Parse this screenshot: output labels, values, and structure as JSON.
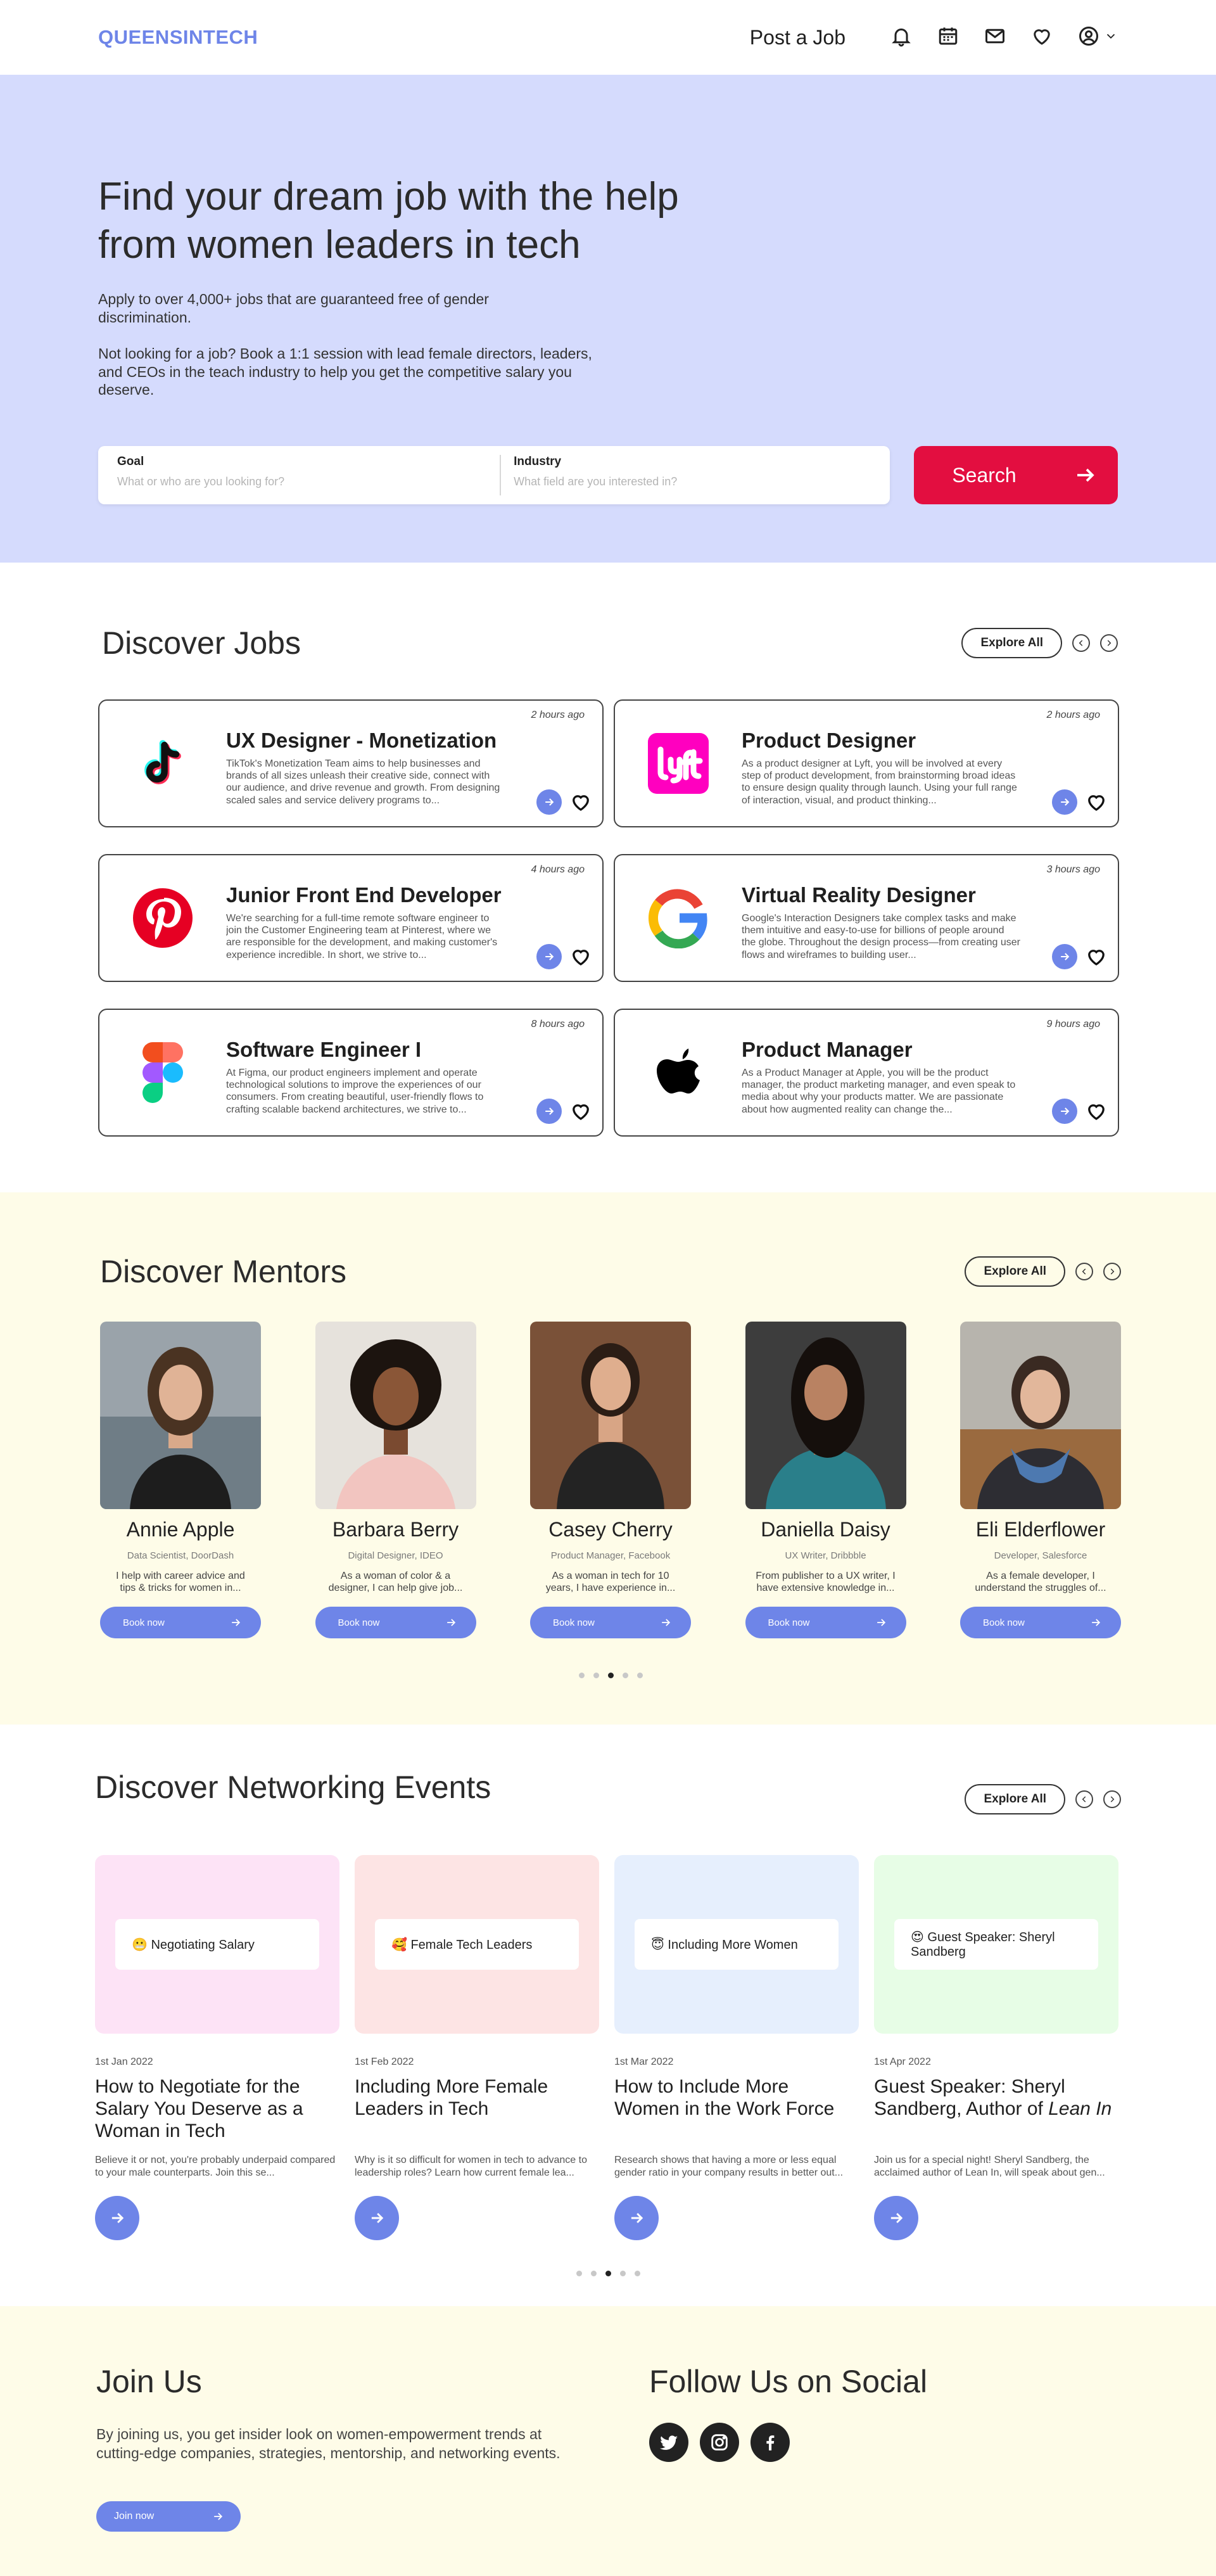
{
  "header": {
    "logo": "QUEENSINTECH",
    "post_job": "Post a Job",
    "icons": [
      "bell-icon",
      "calendar-icon",
      "mail-icon",
      "heart-icon",
      "account-icon",
      "chevron-down-icon"
    ]
  },
  "hero": {
    "title": "Find your dream job with the help from women leaders in tech",
    "subtitle1": "Apply to over 4,000+ jobs that are guaranteed free of gender discrimination.",
    "subtitle2": "Not looking for a job? Book a 1:1 session with lead female directors, leaders, and CEOs in the teach industry to help you get the competitive salary you deserve.",
    "goal_label": "Goal",
    "goal_placeholder": "What or who are you looking for?",
    "industry_label": "Industry",
    "industry_placeholder": "What field are you interested in?",
    "search_label": "Search"
  },
  "jobs": {
    "title": "Discover Jobs",
    "explore_label": "Explore All",
    "items": [
      {
        "company_icon": "tiktok-icon",
        "title": "UX Designer - Monetization",
        "time": "2 hours ago",
        "desc": "TikTok's Monetization Team aims to help businesses and brands of all sizes unleash their creative side, connect with our audience, and drive revenue and growth. From designing scaled sales and service delivery programs to..."
      },
      {
        "company_icon": "lyft-icon",
        "title": "Product Designer",
        "time": "2 hours ago",
        "desc": "As a product designer at Lyft, you will be involved at every step of product development, from brainstorming broad ideas to ensure design quality through launch. Using your full range of interaction, visual, and product thinking..."
      },
      {
        "company_icon": "pinterest-icon",
        "title": "Junior Front End Developer",
        "time": "4 hours ago",
        "desc": "We're searching for a full-time remote software engineer to join the Customer Engineering team at Pinterest, where we are responsible for the development, and making customer's experience incredible. In short, we strive to..."
      },
      {
        "company_icon": "google-icon",
        "title": "Virtual Reality Designer",
        "time": "3 hours ago",
        "desc": "Google's Interaction Designers take complex tasks and make them intuitive and easy-to-use for billions of people around the globe. Throughout the design process—from creating user flows and wireframes to building user..."
      },
      {
        "company_icon": "figma-icon",
        "title": "Software Engineer I",
        "time": "8 hours ago",
        "desc": "At Figma, our product engineers implement and operate technological solutions to improve the experiences of our consumers. From creating beautiful, user-friendly flows to crafting scalable backend architectures, we strive to..."
      },
      {
        "company_icon": "apple-icon",
        "title": "Product Manager",
        "time": "9 hours ago",
        "desc": "As a Product Manager at Apple, you will be the product manager, the product marketing manager, and even speak to media about why your products matter. We are passionate about how augmented reality can change the..."
      }
    ]
  },
  "mentors": {
    "title": "Discover Mentors",
    "explore_label": "Explore All",
    "book_label": "Book now",
    "items": [
      {
        "name": "Annie Apple",
        "role": "Data Scientist, DoorDash",
        "bio": "I help with career advice and tips & tricks for women in..."
      },
      {
        "name": "Barbara Berry",
        "role": "Digital Designer, IDEO",
        "bio": "As a woman of color & a designer, I can help give job..."
      },
      {
        "name": "Casey Cherry",
        "role": "Product Manager, Facebook",
        "bio": "As a woman in tech for 10 years, I have experience in..."
      },
      {
        "name": "Daniella Daisy",
        "role": "UX Writer, Dribbble",
        "bio": "From publisher to a UX writer, I have extensive knowledge in..."
      },
      {
        "name": "Eli Elderflower",
        "role": "Developer, Salesforce",
        "bio": "As a female developer, I understand the struggles of..."
      }
    ]
  },
  "events": {
    "title": "Discover Networking Events",
    "explore_label": "Explore All",
    "items": [
      {
        "tag": "😬 Negotiating Salary",
        "bg": "#fde3f6",
        "date": "1st Jan 2022",
        "title": "How to Negotiate for the Salary You Deserve as a Woman in Tech",
        "desc": "Believe it or not, you're probably underpaid compared to your male counterparts. Join this se..."
      },
      {
        "tag": "🥰 Female Tech Leaders",
        "bg": "#fde4e4",
        "date": "1st Feb 2022",
        "title": "Including More Female Leaders in Tech",
        "desc": "Why is it so difficult for women in tech to advance to leadership roles? Learn how current female lea..."
      },
      {
        "tag": "😇 Including More Women",
        "bg": "#e6effd",
        "date": "1st Mar 2022",
        "title": "How to Include More Women in the Work Force",
        "desc": "Research shows that having a more or less equal gender ratio in your company results in better out..."
      },
      {
        "tag": "😍 Guest Speaker: Sheryl Sandberg",
        "bg": "#e7fde6",
        "date": "1st Apr 2022",
        "title": "Guest Speaker: Sheryl Sandberg, Author of",
        "title_em": "Lean In",
        "desc": "Join us for a special night! Sheryl Sandberg, the acclaimed author of Lean In, will speak about gen..."
      }
    ]
  },
  "footer": {
    "join_title": "Join Us",
    "join_text": "By joining us, you get insider look on women-empowerment trends at cutting-edge companies, strategies, mentorship, and networking events.",
    "join_btn": "Join now",
    "social_title": "Follow Us on Social",
    "social_icons": [
      "twitter-icon",
      "instagram-icon",
      "facebook-icon"
    ]
  },
  "colors": {
    "accent": "#6e85e8",
    "cta": "#e30e40",
    "hero_bg": "#d5dbfd",
    "cream_bg": "#fefce8"
  }
}
